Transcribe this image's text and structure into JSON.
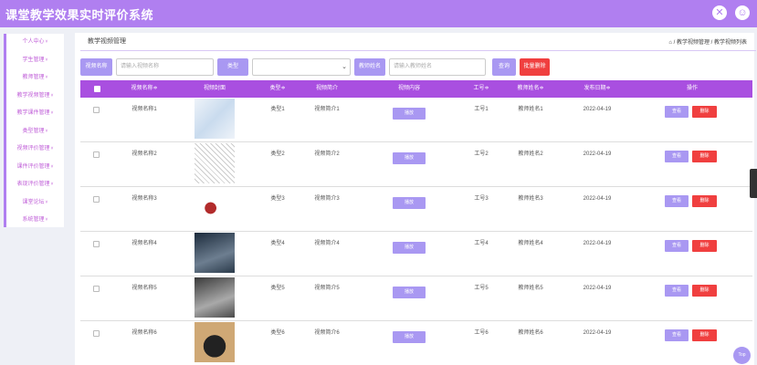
{
  "header": {
    "title": "课堂教学效果实时评价系统",
    "icons": [
      "fullscreen-icon",
      "user-icon"
    ]
  },
  "sidebar": {
    "items": [
      {
        "label": "个人中心"
      },
      {
        "label": "学生管理"
      },
      {
        "label": "教师管理"
      },
      {
        "label": "教学视频管理"
      },
      {
        "label": "教学课件管理"
      },
      {
        "label": "类型管理"
      },
      {
        "label": "视频评价管理"
      },
      {
        "label": "课件评价管理"
      },
      {
        "label": "表现评价管理"
      },
      {
        "label": "课堂论坛"
      },
      {
        "label": "系统管理"
      }
    ]
  },
  "page": {
    "tab": "教学视频管理",
    "breadcrumb": "/ 教学视频管理 / 教学视频列表"
  },
  "search": {
    "name_label": "视频名称",
    "name_placeholder": "请输入视频名称",
    "type_label": "类型",
    "type_value": "",
    "teacher_label": "教师姓名",
    "teacher_placeholder": "请输入教师姓名",
    "query_button": "查询",
    "batch_delete_button": "批量删除"
  },
  "table": {
    "headers": [
      "视频名称≑",
      "视频封面",
      "类型≑",
      "视频简介",
      "视频内容",
      "工号≑",
      "教师姓名≑",
      "发布日期≑",
      "操作"
    ],
    "play_label": "播放",
    "view_label": "查看",
    "delete_label": "删除",
    "rows": [
      {
        "name": "视频名称1",
        "type": "类型1",
        "intro": "视频简介1",
        "job_no": "工号1",
        "teacher": "教师姓名1",
        "date": "2022-04-19"
      },
      {
        "name": "视频名称2",
        "type": "类型2",
        "intro": "视频简介2",
        "job_no": "工号2",
        "teacher": "教师姓名2",
        "date": "2022-04-19"
      },
      {
        "name": "视频名称3",
        "type": "类型3",
        "intro": "视频简介3",
        "job_no": "工号3",
        "teacher": "教师姓名3",
        "date": "2022-04-19"
      },
      {
        "name": "视频名称4",
        "type": "类型4",
        "intro": "视频简介4",
        "job_no": "工号4",
        "teacher": "教师姓名4",
        "date": "2022-04-19"
      },
      {
        "name": "视频名称5",
        "type": "类型5",
        "intro": "视频简介5",
        "job_no": "工号5",
        "teacher": "教师姓名5",
        "date": "2022-04-19"
      },
      {
        "name": "视频名称6",
        "type": "类型6",
        "intro": "视频简介6",
        "job_no": "工号6",
        "teacher": "教师姓名6",
        "date": "2022-04-19"
      }
    ]
  },
  "back_to_top": "Top",
  "colors": {
    "accent": "#b07ff0",
    "table_header": "#a94fe0",
    "button": "#a998f2",
    "danger": "#f03f3f"
  }
}
